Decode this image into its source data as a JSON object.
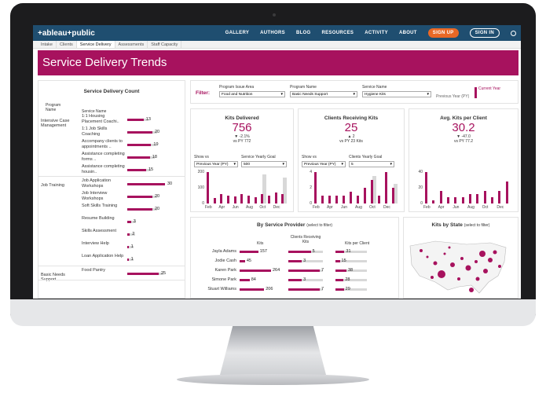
{
  "site": {
    "logo": "+ableau+public",
    "nav": [
      "GALLERY",
      "AUTHORS",
      "BLOG",
      "RESOURCES",
      "ACTIVITY",
      "ABOUT"
    ],
    "signup": "SIGN UP",
    "signin": "SIGN IN"
  },
  "tabs": [
    "Intake",
    "Clients",
    "Service Delivery",
    "Assessments",
    "Staff Capacity"
  ],
  "active_tab": "Service Delivery",
  "title": "Service Delivery Trends",
  "left": {
    "title": "Service Delivery Count",
    "col1": "Program Name",
    "col2": "Service Name",
    "groups": [
      {
        "program": "Intensive Case Management",
        "rows": [
          {
            "name": "1:1 Housing Placement Coachi..",
            "value": 13
          },
          {
            "name": "1:1 Job Skills Coaching",
            "value": 20
          },
          {
            "name": "Accompany clients to appointments ..",
            "value": 19
          },
          {
            "name": "Assistance completing forms ..",
            "value": 18
          },
          {
            "name": "Assistance completing housin..",
            "value": 15
          }
        ]
      },
      {
        "program": "Job Training",
        "rows": [
          {
            "name": "Job Application Workshops",
            "value": 30
          },
          {
            "name": "Job Interview Workshops",
            "value": 20
          },
          {
            "name": "Soft Skills Training",
            "value": 20
          },
          {
            "name": "Resume Building",
            "value": 3
          },
          {
            "name": "Skills Assessment",
            "value": 2
          },
          {
            "name": "Interview Help",
            "value": 1
          },
          {
            "name": "Loan Application Help",
            "value": 1
          }
        ]
      },
      {
        "program": "Basic Needs Support",
        "rows": [
          {
            "name": "Food Pantry",
            "value": 25
          }
        ]
      }
    ]
  },
  "filter": {
    "label": "Filter:",
    "area_label": "Program Issue Area",
    "area_value": "Food and Nutrition",
    "prog_label": "Program Name",
    "prog_value": "Basic Needs Support",
    "svc_label": "Service Name",
    "svc_value": "Hygiene Kits",
    "legend_prev": "Previous Year (PY)",
    "legend_cur": "Current Year"
  },
  "kpis": [
    {
      "title": "Kits Delivered",
      "value": "756",
      "change": "▼ -2.1%",
      "py": "vs PY 772",
      "show_label": "Show vs",
      "show_value": "Previous Year (PY)",
      "goal_label": "Service Yearly Goal",
      "goal_value": "500",
      "yticks": [
        "200",
        "100",
        "0"
      ],
      "xticks": [
        "Feb",
        "Apr",
        "Jun",
        "Aug",
        "Oct",
        "Dec"
      ],
      "cur": [
        230,
        40,
        70,
        60,
        50,
        70,
        60,
        45,
        70,
        60,
        80,
        70
      ],
      "prev": [
        0,
        0,
        0,
        0,
        0,
        0,
        0,
        0,
        210,
        0,
        0,
        190
      ]
    },
    {
      "title": "Clients Receiving Kits",
      "value": "25",
      "change": "▲ 2",
      "py": "vs PY 23 Kits",
      "show_label": "Show vs",
      "show_value": "Previous Year (PY)",
      "goal_label": "Clients Yearly Goal",
      "goal_value": "5",
      "yticks": [
        "4",
        "2",
        "0"
      ],
      "xticks": [
        "Feb",
        "Apr",
        "Jun",
        "Aug",
        "Oct",
        "Dec"
      ],
      "cur": [
        4,
        1,
        1,
        1,
        1,
        1.5,
        1,
        2,
        3,
        1,
        4,
        2
      ],
      "prev": [
        0,
        0,
        0,
        0,
        0,
        0,
        0,
        0,
        3.5,
        0,
        0,
        2.5
      ]
    },
    {
      "title": "Avg. Kits per Client",
      "value": "30.2",
      "change": "▼ -47.0",
      "py": "vs PY 77.2",
      "yticks": [
        "40",
        "20",
        "0"
      ],
      "xticks": [
        "Feb",
        "Apr",
        "Jun",
        "Aug",
        "Oct",
        "Dec"
      ],
      "cur": [
        50,
        5,
        20,
        10,
        10,
        10,
        15,
        15,
        20,
        10,
        20,
        35
      ],
      "prev": [
        0,
        0,
        0,
        0,
        0,
        0,
        0,
        0,
        0,
        0,
        0,
        0
      ]
    }
  ],
  "provider": {
    "title": "By Service Provider",
    "hint": "(select to filter)",
    "col_kits": "Kits",
    "col_clients": "Clients Receiving Kits",
    "col_per": "Kits per Client",
    "rows": [
      {
        "name": "Jayla Adams",
        "kits": 157,
        "clients": 5,
        "per": 31
      },
      {
        "name": "Jodie Cash",
        "kits": 45,
        "clients": 3,
        "per": 15
      },
      {
        "name": "Karen Park",
        "kits": 264,
        "clients": 7,
        "per": 38
      },
      {
        "name": "Simone Park",
        "kits": 84,
        "clients": 3,
        "per": 28
      },
      {
        "name": "Stuart Williams",
        "kits": 206,
        "clients": 7,
        "per": 29
      }
    ]
  },
  "state": {
    "title": "Kits by State",
    "hint": "(select to filter)"
  }
}
